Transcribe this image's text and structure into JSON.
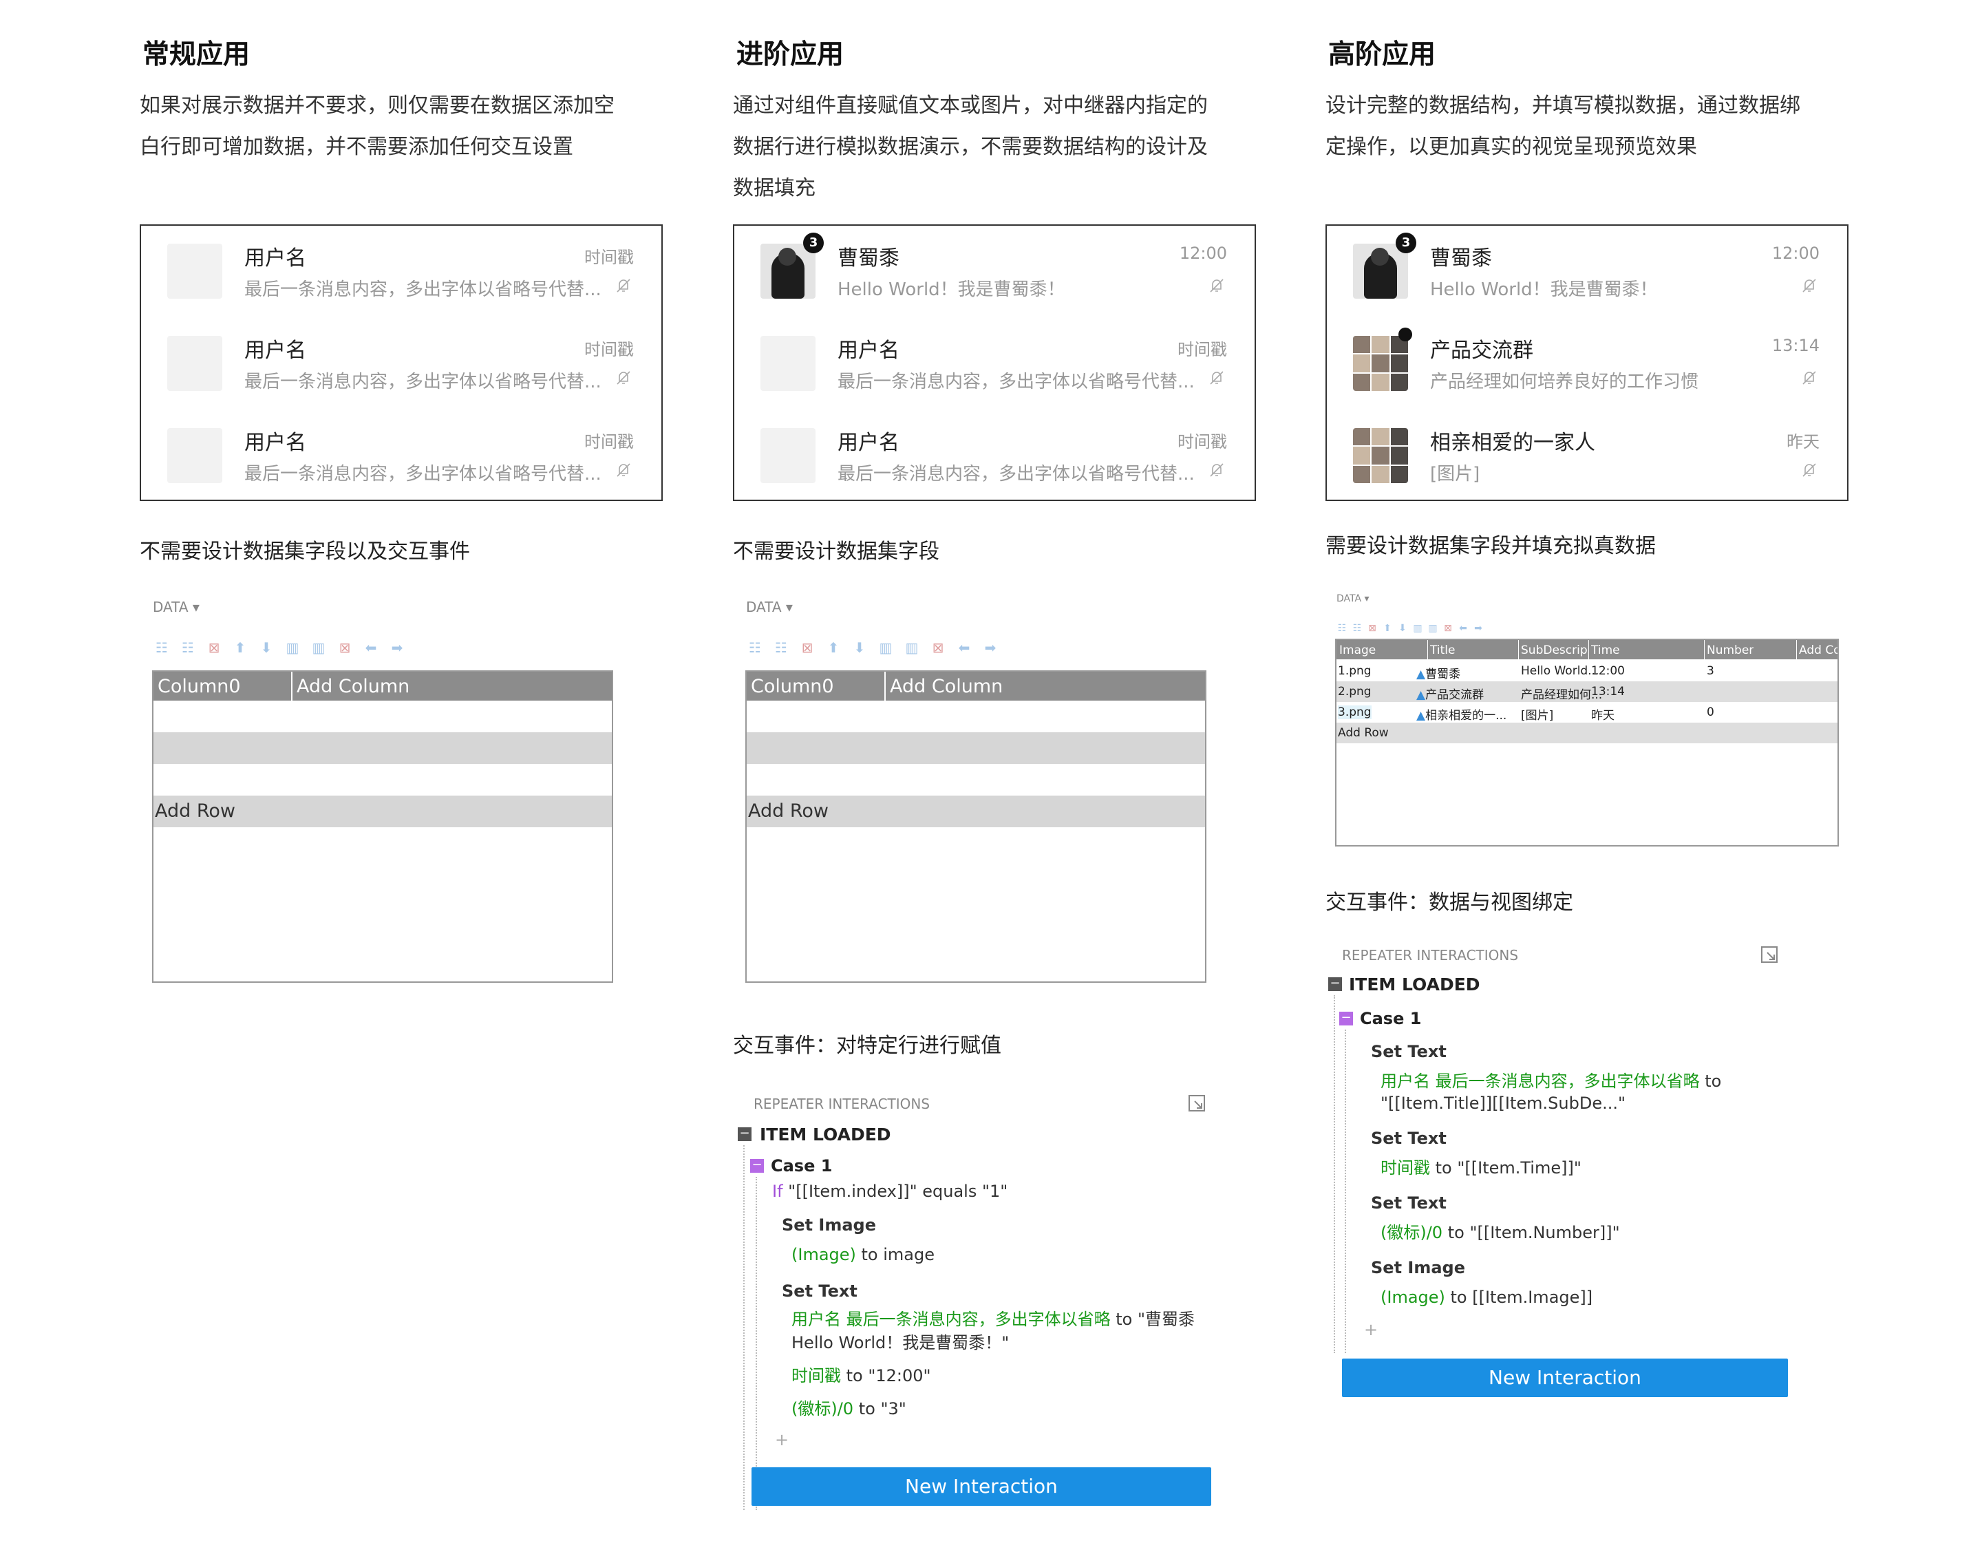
{
  "columns": [
    {
      "heading": "常规应用",
      "description": [
        "如果对展示数据并不要求，则仅需要在数据区添加空",
        "白行即可增加数据，并不需要添加任何交互设置"
      ],
      "rows": [
        {
          "title": "用户名",
          "sub": "最后一条消息内容，多出字体以省略号代替...",
          "time": "时间戳"
        },
        {
          "title": "用户名",
          "sub": "最后一条消息内容，多出字体以省略号代替...",
          "time": "时间戳"
        },
        {
          "title": "用户名",
          "sub": "最后一条消息内容，多出字体以省略号代替...",
          "time": "时间戳"
        }
      ],
      "caption": "不需要设计数据集字段以及交互事件",
      "data_header": "DATA ▾",
      "grid_columns": [
        "Column0",
        "Add Column"
      ],
      "add_row": "Add Row"
    },
    {
      "heading": "进阶应用",
      "description": [
        "通过对组件直接赋值文本或图片，对中继器内指定的",
        "数据行进行模拟数据演示，不需要数据结构的设计及",
        "数据填充"
      ],
      "rows": [
        {
          "title": "曹蜀黍",
          "sub": "Hello World！我是曹蜀黍！",
          "time": "12:00",
          "badge": "3"
        },
        {
          "title": "用户名",
          "sub": "最后一条消息内容，多出字体以省略号代替...",
          "time": "时间戳"
        },
        {
          "title": "用户名",
          "sub": "最后一条消息内容，多出字体以省略号代替...",
          "time": "时间戳"
        }
      ],
      "caption": "不需要设计数据集字段",
      "data_header": "DATA ▾",
      "grid_columns": [
        "Column0",
        "Add Column"
      ],
      "add_row": "Add Row",
      "interactions_caption": "交互事件：对特定行进行赋值",
      "interactions": {
        "panel_title": "REPEATER INTERACTIONS",
        "event": "ITEM LOADED",
        "case": "Case 1",
        "condition_if": "If",
        "condition_rest": "\"[[Item.index]]\" equals \"1\"",
        "set_image": "Set Image",
        "image_target": "(Image)",
        "image_value": " to image",
        "set_text": "Set Text",
        "text_targets": "用户名 最后一条消息内容，多出字体以省略",
        "text_value_1": " to \"曹蜀黍",
        "text_value_2": "Hello World！我是曹蜀黍！\"",
        "time_target": "时间戳",
        "time_value": " to \"12:00\"",
        "badge_target": "(徽标)/0",
        "badge_value": " to \"3\"",
        "add": "+",
        "button": "New Interaction"
      }
    },
    {
      "heading": "高阶应用",
      "description": [
        "设计完整的数据结构，并填写模拟数据，通过数据绑",
        "定操作，以更加真实的视觉呈现预览效果"
      ],
      "rows": [
        {
          "title": "曹蜀黍",
          "sub": "Hello World！我是曹蜀黍！",
          "time": "12:00",
          "badge": "3"
        },
        {
          "title": "产品交流群",
          "sub": "产品经理如何培养良好的工作习惯",
          "time": "13:14"
        },
        {
          "title": "相亲相爱的一家人",
          "sub": "[图片]",
          "time": "昨天"
        }
      ],
      "caption": "需要设计数据集字段并填充拟真数据",
      "data_header": "DATA ▾",
      "table": {
        "headers": [
          "Image",
          "Title",
          "SubDescripti...",
          "Time",
          "Number",
          "Add Co"
        ],
        "rows": [
          [
            "1.png",
            "曹蜀黍",
            "Hello World...",
            "12:00",
            "3"
          ],
          [
            "2.png",
            "产品交流群",
            "产品经理如何...",
            "13:14",
            ""
          ],
          [
            "3.png",
            "相亲相爱的一...",
            "[图片]",
            "昨天",
            "0"
          ]
        ],
        "add_row": "Add Row"
      },
      "interactions_caption": "交互事件：数据与视图绑定",
      "interactions": {
        "panel_title": "REPEATER INTERACTIONS",
        "event": "ITEM LOADED",
        "case": "Case 1",
        "set_text": "Set Text",
        "text_targets": "用户名 最后一条消息内容，多出字体以省略",
        "text_value_1": " to",
        "text_value_2": "\"[[Item.Title]][[Item.SubDe...\"",
        "time_target": "时间戳",
        "time_value": " to \"[[Item.Time]]\"",
        "badge_target": "(徽标)/0",
        "badge_value": " to \"[[Item.Number]]\"",
        "set_image": "Set Image",
        "image_target": "(Image)",
        "image_value": " to [[Item.Image]]",
        "add": "+",
        "button": "New Interaction"
      }
    }
  ],
  "colors": {
    "accent": "#1a8fe3",
    "case": "#b56ae6",
    "target": "#1a9a1a"
  }
}
